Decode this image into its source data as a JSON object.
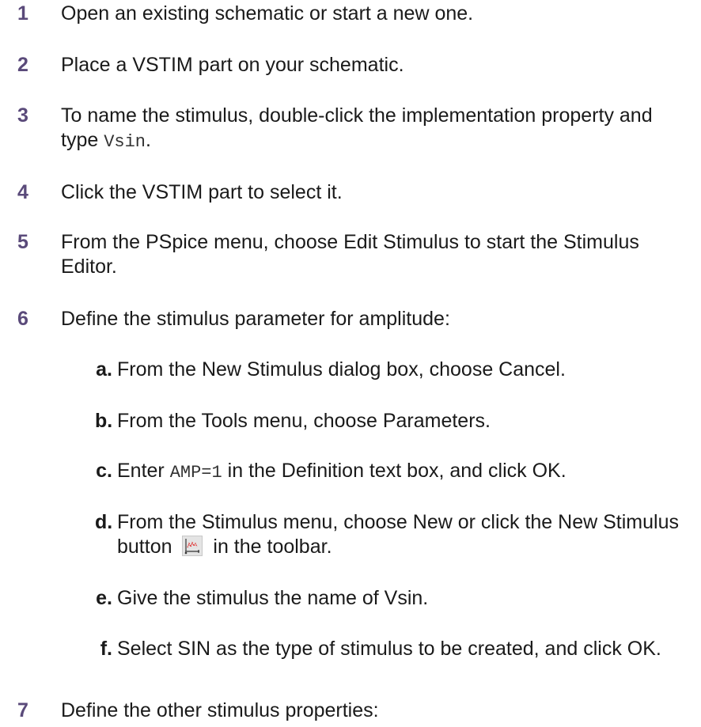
{
  "steps": [
    {
      "num": "1",
      "text": "Open an existing schematic or start a new one."
    },
    {
      "num": "2",
      "text": "Place a VSTIM part on your schematic."
    },
    {
      "num": "3",
      "text_a": "To name the stimulus, double-click the implementation property and type ",
      "code": "Vsin",
      "text_b": "."
    },
    {
      "num": "4",
      "text": "Click the VSTIM part to select it."
    },
    {
      "num": "5",
      "text": "From the PSpice menu, choose Edit Stimulus to start the Stimulus Editor."
    },
    {
      "num": "6",
      "text": "Define the stimulus parameter for amplitude:"
    },
    {
      "num": "7",
      "text": "Define the other stimulus properties:"
    }
  ],
  "substeps": [
    {
      "letter": "a.",
      "text": "From the New Stimulus dialog box, choose Cancel."
    },
    {
      "letter": "b.",
      "text": "From the Tools menu, choose Parameters."
    },
    {
      "letter": "c.",
      "text_a": "Enter ",
      "code": "AMP=1",
      "text_b": " in the Definition text box, and click OK."
    },
    {
      "letter": "d.",
      "text_a": "From the Stimulus menu, choose New or click the New Stimulus button ",
      "icon": "new-stimulus-icon",
      "text_b": " in the toolbar."
    },
    {
      "letter": "e.",
      "text": "Give the stimulus the name of Vsin."
    },
    {
      "letter": "f.",
      "text": "Select SIN as the type of stimulus to be created, and click OK."
    }
  ],
  "colors": {
    "step_number": "#5a4a7a",
    "text": "#1a1a1a"
  }
}
